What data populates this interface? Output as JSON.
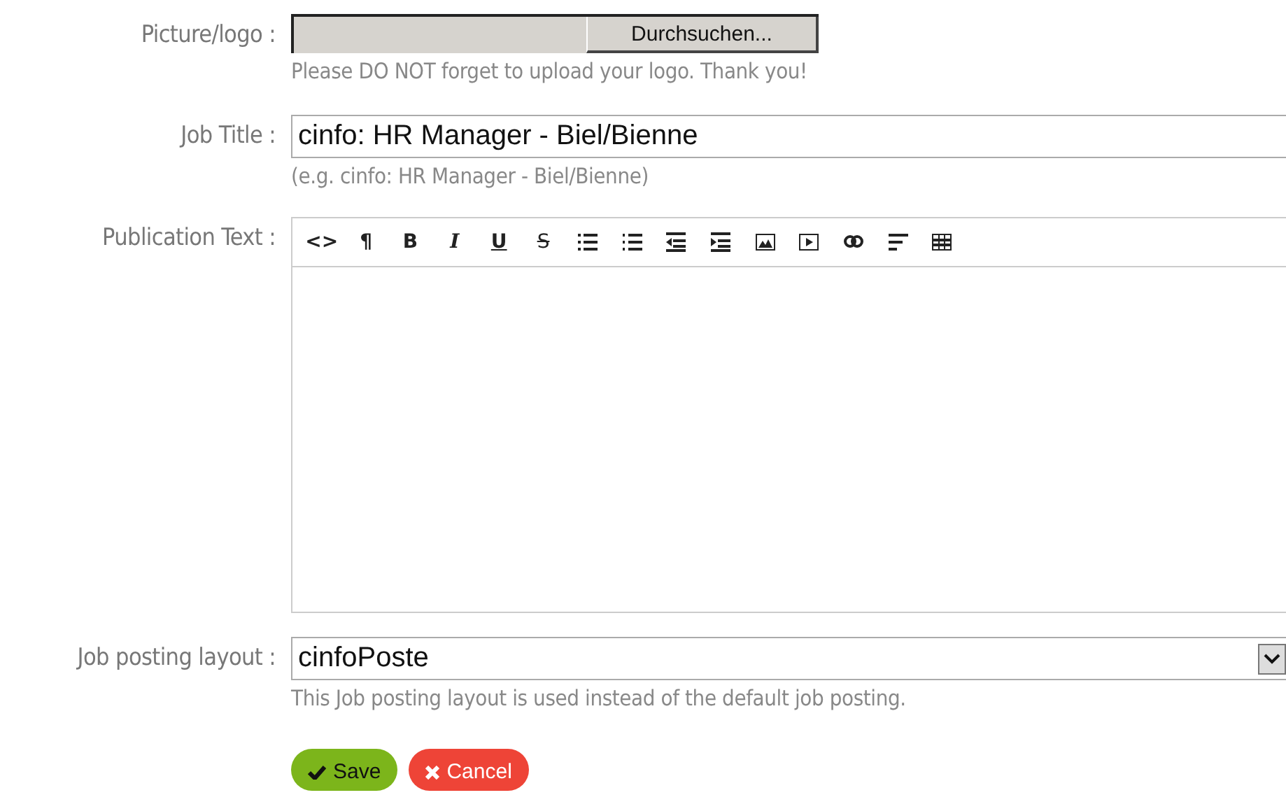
{
  "picture_logo": {
    "label": "Picture/logo :",
    "button": "Durchsuchen...",
    "hint": "Please DO NOT forget to upload your logo. Thank you!"
  },
  "job_title": {
    "label": "Job Title :",
    "value": "cinfo: HR Manager - Biel/Bienne",
    "hint": "(e.g. cinfo: HR Manager - Biel/Bienne)"
  },
  "publication_text": {
    "label": "Publication Text :",
    "toolbar": [
      {
        "kind": "code",
        "glyph": "<>"
      },
      {
        "kind": "paragraph",
        "glyph": "¶"
      },
      {
        "kind": "bold",
        "glyph": "B"
      },
      {
        "kind": "italic",
        "glyph": "I"
      },
      {
        "kind": "underline",
        "glyph": "U"
      },
      {
        "kind": "strike",
        "glyph": "S"
      },
      {
        "kind": "bullets"
      },
      {
        "kind": "numbers"
      },
      {
        "kind": "outdent"
      },
      {
        "kind": "indent"
      },
      {
        "kind": "image"
      },
      {
        "kind": "video"
      },
      {
        "kind": "link"
      },
      {
        "kind": "align"
      },
      {
        "kind": "table"
      }
    ]
  },
  "layout": {
    "label": "Job posting layout :",
    "value": "cinfoPoste",
    "hint": "This Job posting layout is used instead of the default job posting."
  },
  "buttons": [
    {
      "kind": "save",
      "label": "Save"
    },
    {
      "kind": "cancel",
      "label": "Cancel"
    }
  ]
}
